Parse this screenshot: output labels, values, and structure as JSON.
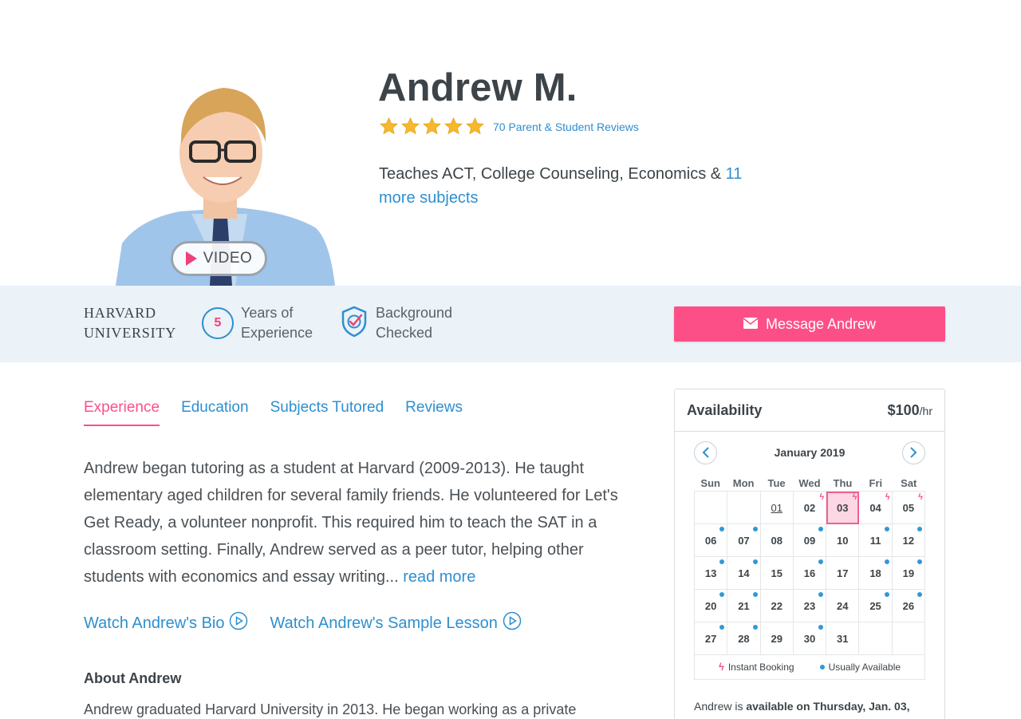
{
  "profile": {
    "name": "Andrew M.",
    "reviews_link": "70 Parent & Student Reviews",
    "rating_stars": 5,
    "teaches_prefix": "Teaches ACT, College Counseling, Economics & ",
    "teaches_more": "11 more subjects",
    "video_label": "VIDEO"
  },
  "banner": {
    "school_line1": "HARVARD",
    "school_line2": "UNIVERSITY",
    "years_value": "5",
    "years_line1": "Years of",
    "years_line2": "Experience",
    "bg_line1": "Background",
    "bg_line2": "Checked",
    "message_label": "Message Andrew"
  },
  "tabs": [
    {
      "label": "Experience",
      "active": true
    },
    {
      "label": "Education",
      "active": false
    },
    {
      "label": "Subjects Tutored",
      "active": false
    },
    {
      "label": "Reviews",
      "active": false
    }
  ],
  "experience": {
    "text": "Andrew began tutoring as a student at Harvard (2009-2013). He taught elementary aged children for several family friends. He volunteered for Let's Get Ready, a volunteer nonprofit. This required him to teach the SAT in a classroom setting. Finally, Andrew served as a peer tutor, helping other students with economics and essay writing... ",
    "read_more": "read more",
    "watch_bio": "Watch Andrew's Bio",
    "watch_lesson": "Watch Andrew's Sample Lesson"
  },
  "about": {
    "title": "About Andrew",
    "text": "Andrew graduated Harvard University in 2013. He began working as a private"
  },
  "availability": {
    "title": "Availability",
    "price": "$100",
    "price_unit": "/hr",
    "month": "January 2019",
    "weekdays": [
      "Sun",
      "Mon",
      "Tue",
      "Wed",
      "Thu",
      "Fri",
      "Sat"
    ],
    "days": [
      {
        "d": "",
        "m": ""
      },
      {
        "d": "",
        "m": ""
      },
      {
        "d": "01",
        "m": "today"
      },
      {
        "d": "02",
        "m": "bolt"
      },
      {
        "d": "03",
        "m": "bolt-sel"
      },
      {
        "d": "04",
        "m": "bolt"
      },
      {
        "d": "05",
        "m": "bolt"
      },
      {
        "d": "06",
        "m": "dot"
      },
      {
        "d": "07",
        "m": "dot"
      },
      {
        "d": "08",
        "m": ""
      },
      {
        "d": "09",
        "m": "dot"
      },
      {
        "d": "10",
        "m": ""
      },
      {
        "d": "11",
        "m": "dot"
      },
      {
        "d": "12",
        "m": "dot"
      },
      {
        "d": "13",
        "m": "dot"
      },
      {
        "d": "14",
        "m": "dot"
      },
      {
        "d": "15",
        "m": ""
      },
      {
        "d": "16",
        "m": "dot"
      },
      {
        "d": "17",
        "m": ""
      },
      {
        "d": "18",
        "m": "dot"
      },
      {
        "d": "19",
        "m": "dot"
      },
      {
        "d": "20",
        "m": "dot"
      },
      {
        "d": "21",
        "m": "dot"
      },
      {
        "d": "22",
        "m": ""
      },
      {
        "d": "23",
        "m": "dot"
      },
      {
        "d": "24",
        "m": ""
      },
      {
        "d": "25",
        "m": "dot"
      },
      {
        "d": "26",
        "m": "dot"
      },
      {
        "d": "27",
        "m": "dot"
      },
      {
        "d": "28",
        "m": "dot"
      },
      {
        "d": "29",
        "m": ""
      },
      {
        "d": "30",
        "m": "dot"
      },
      {
        "d": "31",
        "m": ""
      },
      {
        "d": "",
        "m": ""
      },
      {
        "d": "",
        "m": ""
      }
    ],
    "legend_instant": "Instant Booking",
    "legend_usual": "Usually Available",
    "note_prefix": "Andrew is ",
    "note_bold": "available on Thursday, Jan. 03,",
    "accent_pink": "#fd4f87",
    "accent_blue": "#2e8fcf"
  }
}
